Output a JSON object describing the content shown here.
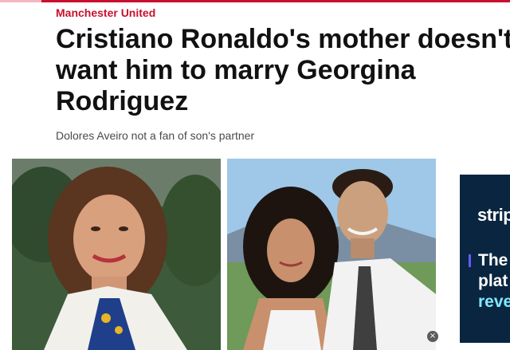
{
  "article": {
    "category": "Manchester United",
    "headline": "Cristiano Ronaldo's mother doesn't want him to marry Georgina Rodriguez",
    "subheadline": "Dolores Aveiro not a fan of son's partner"
  },
  "images": {
    "left_photo": "photo-mother",
    "right_photo": "photo-couple"
  },
  "ad": {
    "brand": "strip",
    "line1": "The",
    "line2": "plat",
    "line3": "reve",
    "close_icon": "×"
  },
  "colors": {
    "accent": "#c8102e",
    "ad_background": "#0a2540",
    "ad_highlight": "#80e9ff"
  }
}
